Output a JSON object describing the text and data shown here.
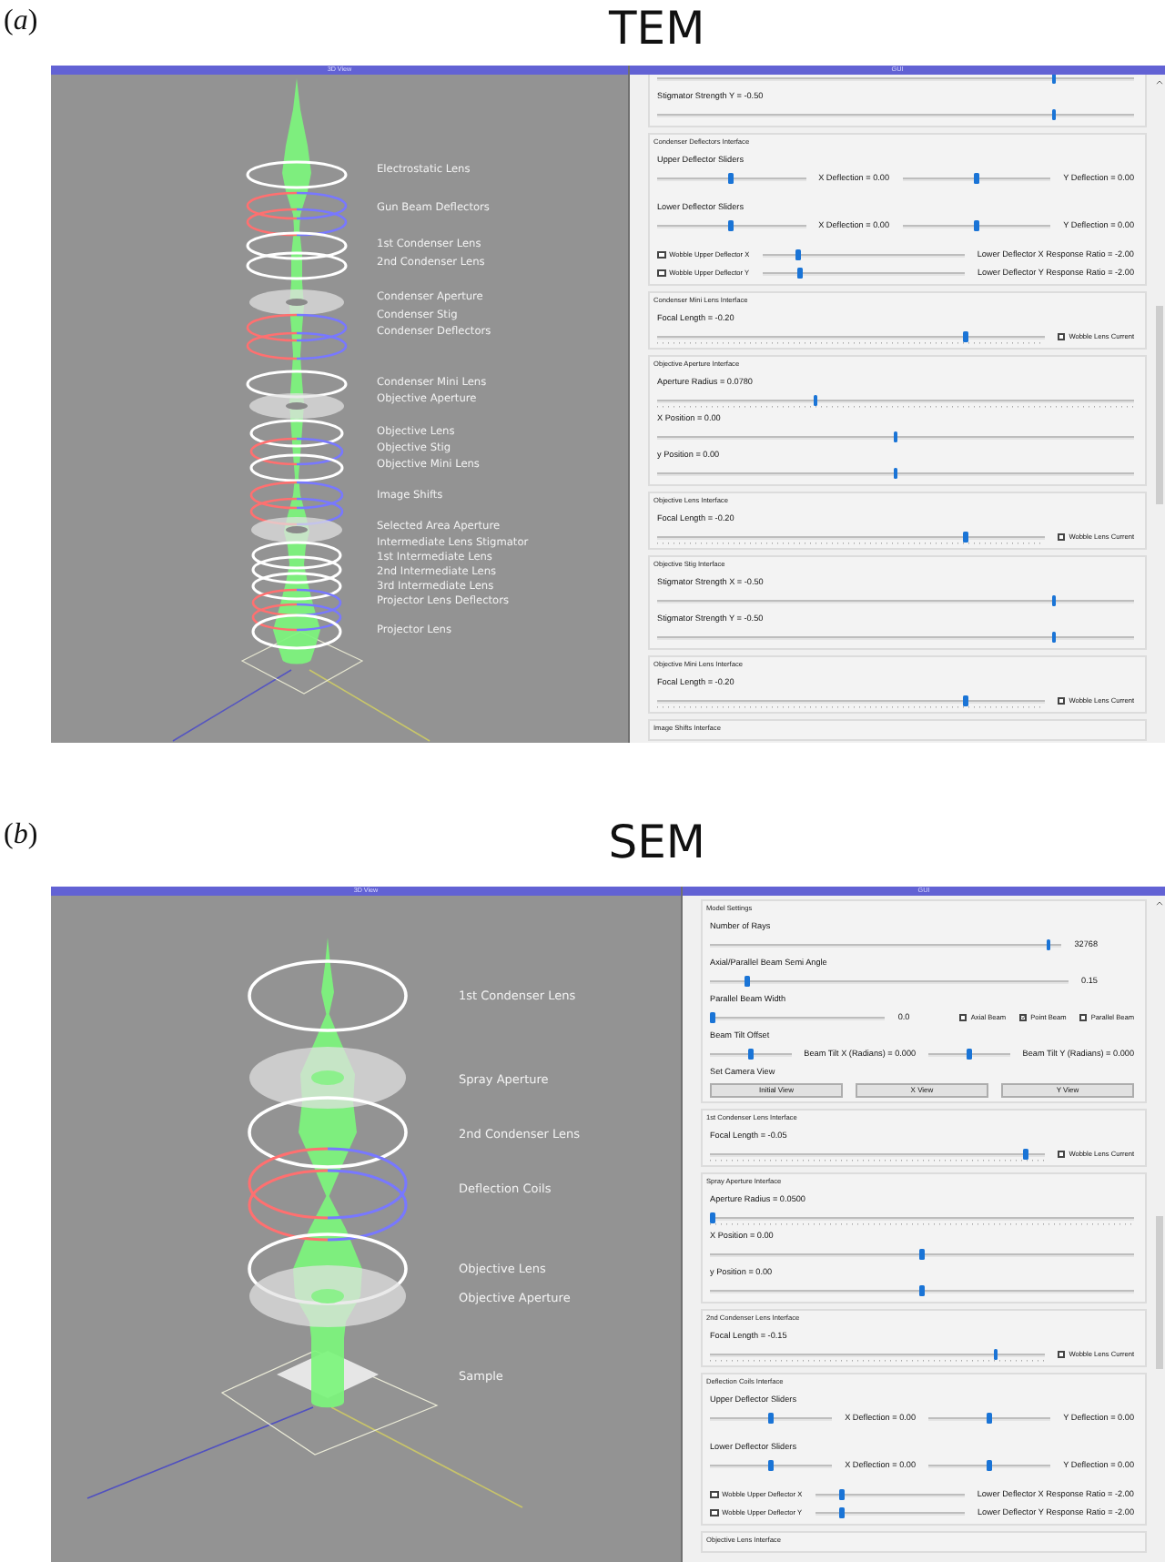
{
  "panels": [
    {
      "kind": "tem",
      "label": "(*a*)",
      "title": "TEM",
      "view": {
        "title": "3D View",
        "labels": [
          "Electrostatic Lens",
          "Gun Beam Deflectors",
          "1st Condenser Lens",
          "2nd Condenser Lens",
          "Condenser Aperture",
          "Condenser Stig",
          "Condenser Deflectors",
          "Condenser Mini Lens",
          "Objective Aperture",
          "Objective Lens",
          "Objective Stig",
          "Objective Mini Lens",
          "Image Shifts",
          "Selected Area Aperture",
          "Intermediate Lens Stigmator",
          "1st Intermediate Lens",
          "2nd Intermediate Lens",
          "3rd Intermediate Lens",
          "Projector Lens Deflectors",
          "Projector Lens"
        ]
      },
      "gui": {
        "title": "GUI",
        "groups": [
          {
            "rows": [
              {
                "items": [
                  {
                    "kind": "slider",
                    "level": 0.835
                  }
                ]
              },
              {
                "items": [
                  {
                    "kind": "text",
                    "text": "Stigmator Strength Y = -0.50"
                  }
                ]
              },
              {
                "items": [
                  {
                    "kind": "slider",
                    "level": 0.835
                  }
                ]
              }
            ]
          },
          {
            "title": "Condenser Deflectors Interface",
            "rows": [
              {
                "items": [
                  {
                    "kind": "text",
                    "text": "Upper Deflector Sliders"
                  }
                ]
              },
              {
                "items": [
                  {
                    "kind": "slider",
                    "level": 0.5
                  },
                  {
                    "kind": "text",
                    "text": "X Deflection = 0.00"
                  },
                  {
                    "kind": "slider",
                    "level": 0.5
                  },
                  {
                    "kind": "text",
                    "text": "Y Deflection = 0.00"
                  }
                ]
              },
              {
                "items": [
                  {
                    "kind": "text",
                    "text": "Lower Deflector Sliders"
                  }
                ]
              },
              {
                "items": [
                  {
                    "kind": "slider",
                    "level": 0.5
                  },
                  {
                    "kind": "text",
                    "text": "X Deflection = 0.00"
                  },
                  {
                    "kind": "slider",
                    "level": 0.5
                  },
                  {
                    "kind": "text",
                    "text": "Y Deflection = 0.00"
                  }
                ]
              },
              {
                "items": [
                  {
                    "kind": "checkbox",
                    "label": "Wobble Upper Deflector X",
                    "checked": false
                  },
                  {
                    "kind": "slider",
                    "level": 0.17
                  },
                  {
                    "kind": "text",
                    "text": "Lower Deflector X Response Ratio = -2.00"
                  }
                ]
              },
              {
                "items": [
                  {
                    "kind": "checkbox",
                    "label": "Wobble Upper Deflector Y",
                    "checked": false
                  },
                  {
                    "kind": "slider",
                    "level": 0.18
                  },
                  {
                    "kind": "text",
                    "text": "Lower Deflector Y Response Ratio = -2.00"
                  }
                ]
              }
            ]
          },
          {
            "title": "Condenser Mini Lens Interface",
            "rows": [
              {
                "items": [
                  {
                    "kind": "text",
                    "text": "Focal Length = -0.20"
                  }
                ]
              },
              {
                "items": [
                  {
                    "kind": "tick_slider",
                    "level": 0.8
                  },
                  {
                    "kind": "checkbox",
                    "label": "Wobble Lens Current",
                    "checked": false
                  }
                ]
              }
            ]
          },
          {
            "title": "Objective Aperture Interface",
            "rows": [
              {
                "items": [
                  {
                    "kind": "text",
                    "text": "Aperture Radius = 0.0780"
                  }
                ]
              },
              {
                "items": [
                  {
                    "kind": "tick_slider",
                    "level": 0.33
                  }
                ]
              },
              {
                "items": [
                  {
                    "kind": "text",
                    "text": "X Position = 0.00"
                  }
                ]
              },
              {
                "items": [
                  {
                    "kind": "slider",
                    "level": 0.5
                  }
                ]
              },
              {
                "items": [
                  {
                    "kind": "text",
                    "text": "y Position = 0.00"
                  }
                ]
              },
              {
                "items": [
                  {
                    "kind": "slider",
                    "level": 0.5
                  }
                ]
              }
            ]
          },
          {
            "title": "Objective Lens Interface",
            "rows": [
              {
                "items": [
                  {
                    "kind": "text",
                    "text": "Focal Length = -0.20"
                  }
                ]
              },
              {
                "items": [
                  {
                    "kind": "tick_slider",
                    "level": 0.8
                  },
                  {
                    "kind": "checkbox",
                    "label": "Wobble Lens Current",
                    "checked": false
                  }
                ]
              }
            ]
          },
          {
            "title": "Objective Stig Interface",
            "rows": [
              {
                "items": [
                  {
                    "kind": "text",
                    "text": "Stigmator Strength X = -0.50"
                  }
                ]
              },
              {
                "items": [
                  {
                    "kind": "slider",
                    "level": 0.835
                  }
                ]
              },
              {
                "items": [
                  {
                    "kind": "text",
                    "text": "Stigmator Strength Y = -0.50"
                  }
                ]
              },
              {
                "items": [
                  {
                    "kind": "slider",
                    "level": 0.835
                  }
                ]
              }
            ]
          },
          {
            "title": "Objective Mini Lens Interface",
            "rows": [
              {
                "items": [
                  {
                    "kind": "text",
                    "text": "Focal Length = -0.20"
                  }
                ]
              },
              {
                "items": [
                  {
                    "kind": "tick_slider",
                    "level": 0.8
                  },
                  {
                    "kind": "checkbox",
                    "label": "Wobble Lens Current",
                    "checked": false
                  }
                ]
              }
            ]
          },
          {
            "title": "Image Shifts Interface"
          }
        ]
      }
    },
    {
      "kind": "sem",
      "label": "(*b*)",
      "title": "SEM",
      "view": {
        "title": "3D View",
        "labels": [
          "1st Condenser Lens",
          "Spray Aperture",
          "2nd Condenser Lens",
          "Deflection Coils",
          "Objective Lens",
          "Objective Aperture",
          "Sample"
        ]
      },
      "gui": {
        "title": "GUI",
        "groups": [
          {
            "title": "Model Settings",
            "rows": [
              {
                "items": [
                  {
                    "kind": "text",
                    "text": "Number of Rays"
                  }
                ]
              },
              {
                "items": [
                  {
                    "kind": "slider",
                    "level": 0.97
                  },
                  {
                    "kind": "value",
                    "text": "32768"
                  }
                ]
              },
              {
                "items": [
                  {
                    "kind": "text",
                    "text": "Axial/Parallel Beam Semi Angle"
                  }
                ]
              },
              {
                "items": [
                  {
                    "kind": "slider",
                    "level": 0.1
                  },
                  {
                    "kind": "value",
                    "text": "0.15"
                  }
                ]
              },
              {
                "items": [
                  {
                    "kind": "text",
                    "text": "Parallel Beam Width"
                  }
                ]
              },
              {
                "items": [
                  {
                    "kind": "slider",
                    "level": 0.0
                  },
                  {
                    "kind": "value",
                    "text": "0.0"
                  },
                  {
                    "kind": "checkbox",
                    "label": "Axial Beam",
                    "checked": false
                  },
                  {
                    "kind": "checkbox",
                    "label": "Point Beam",
                    "checked": true
                  },
                  {
                    "kind": "checkbox",
                    "label": "Parallel Beam",
                    "checked": false
                  }
                ]
              },
              {
                "items": [
                  {
                    "kind": "text",
                    "text": "Beam Tilt Offset"
                  }
                ]
              },
              {
                "items": [
                  {
                    "kind": "slider",
                    "level": 0.5
                  },
                  {
                    "kind": "text",
                    "text": "Beam Tilt X (Radians) = 0.000"
                  },
                  {
                    "kind": "slider",
                    "level": 0.5
                  },
                  {
                    "kind": "text",
                    "text": "Beam Tilt Y (Radians) = 0.000"
                  }
                ]
              },
              {
                "items": [
                  {
                    "kind": "text",
                    "text": "Set Camera View"
                  }
                ]
              },
              {
                "items": [
                  {
                    "kind": "button",
                    "label": "Initial View"
                  },
                  {
                    "kind": "button",
                    "label": "X View"
                  },
                  {
                    "kind": "button",
                    "label": "Y View"
                  }
                ]
              }
            ]
          },
          {
            "title": "1st Condenser Lens Interface",
            "rows": [
              {
                "items": [
                  {
                    "kind": "text",
                    "text": "Focal Length = -0.05"
                  }
                ]
              },
              {
                "items": [
                  {
                    "kind": "tick_slider",
                    "level": 0.95
                  },
                  {
                    "kind": "checkbox",
                    "label": "Wobble Lens Current",
                    "checked": false
                  }
                ]
              }
            ]
          },
          {
            "title": "Spray Aperture Interface",
            "rows": [
              {
                "items": [
                  {
                    "kind": "text",
                    "text": "Aperture Radius = 0.0500"
                  }
                ]
              },
              {
                "items": [
                  {
                    "kind": "tick_slider",
                    "level": 0.0
                  }
                ]
              },
              {
                "items": [
                  {
                    "kind": "text",
                    "text": "X Position = 0.00"
                  }
                ]
              },
              {
                "items": [
                  {
                    "kind": "slider",
                    "level": 0.5
                  }
                ]
              },
              {
                "items": [
                  {
                    "kind": "text",
                    "text": "y Position = 0.00"
                  }
                ]
              },
              {
                "items": [
                  {
                    "kind": "slider",
                    "level": 0.5
                  }
                ]
              }
            ]
          },
          {
            "title": "2nd Condenser Lens Interface",
            "rows": [
              {
                "items": [
                  {
                    "kind": "text",
                    "text": "Focal Length = -0.15"
                  }
                ]
              },
              {
                "items": [
                  {
                    "kind": "tick_slider",
                    "level": 0.86
                  },
                  {
                    "kind": "checkbox",
                    "label": "Wobble Lens Current",
                    "checked": false
                  }
                ]
              }
            ]
          },
          {
            "title": "Deflection Coils Interface",
            "rows": [
              {
                "items": [
                  {
                    "kind": "text",
                    "text": "Upper Deflector Sliders"
                  }
                ]
              },
              {
                "items": [
                  {
                    "kind": "slider",
                    "level": 0.5
                  },
                  {
                    "kind": "text",
                    "text": "X Deflection = 0.00"
                  },
                  {
                    "kind": "slider",
                    "level": 0.5
                  },
                  {
                    "kind": "text",
                    "text": "Y Deflection = 0.00"
                  }
                ]
              },
              {
                "items": [
                  {
                    "kind": "text",
                    "text": "Lower Deflector Sliders"
                  }
                ]
              },
              {
                "items": [
                  {
                    "kind": "slider",
                    "level": 0.5
                  },
                  {
                    "kind": "text",
                    "text": "X Deflection = 0.00"
                  },
                  {
                    "kind": "slider",
                    "level": 0.5
                  },
                  {
                    "kind": "text",
                    "text": "Y Deflection = 0.00"
                  }
                ]
              },
              {
                "items": [
                  {
                    "kind": "checkbox",
                    "label": "Wobble Upper Deflector X",
                    "checked": false
                  },
                  {
                    "kind": "slider",
                    "level": 0.17
                  },
                  {
                    "kind": "text",
                    "text": "Lower Deflector X Response Ratio = -2.00"
                  }
                ]
              },
              {
                "items": [
                  {
                    "kind": "checkbox",
                    "label": "Wobble Upper Deflector Y",
                    "checked": false
                  },
                  {
                    "kind": "slider",
                    "level": 0.17
                  },
                  {
                    "kind": "text",
                    "text": "Lower Deflector Y Response Ratio = -2.00"
                  }
                ]
              }
            ]
          },
          {
            "title": "Objective Lens Interface"
          }
        ]
      }
    }
  ]
}
